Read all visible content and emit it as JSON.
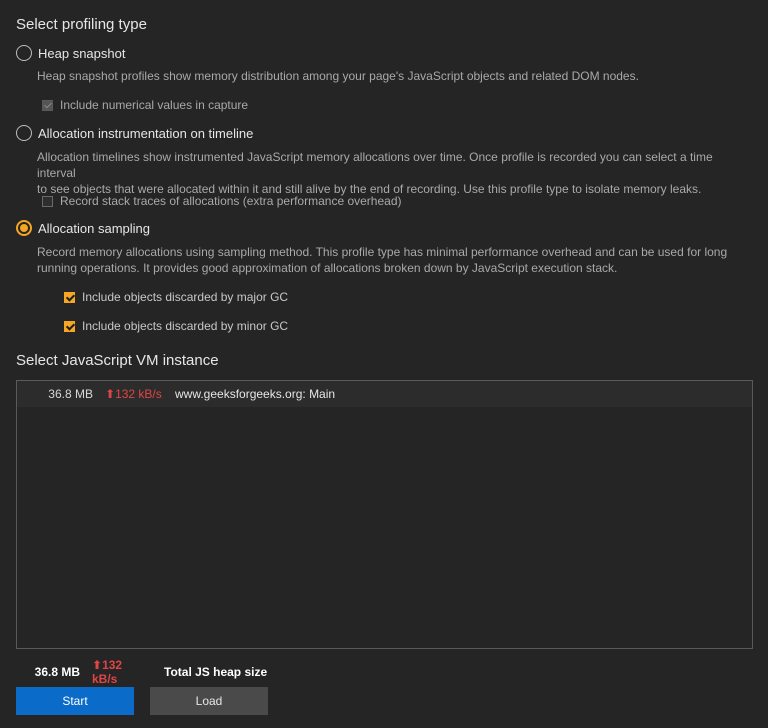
{
  "profiling": {
    "title": "Select profiling type",
    "options": [
      {
        "label": "Heap snapshot",
        "selected": false,
        "description": "Heap snapshot profiles show memory distribution among your page's JavaScript objects and related DOM nodes.",
        "checkboxes": [
          {
            "label": "Include numerical values in capture",
            "checked": true,
            "disabled": true
          }
        ]
      },
      {
        "label": "Allocation instrumentation on timeline",
        "selected": false,
        "description_lines": [
          "Allocation timelines show instrumented JavaScript memory allocations over time. Once profile is recorded you can select a time interval",
          "to see objects that were allocated within it and still alive by the end of recording. Use this profile type to isolate memory leaks."
        ],
        "checkboxes": [
          {
            "label": "Record stack traces of allocations (extra performance overhead)",
            "checked": false,
            "disabled": true
          }
        ]
      },
      {
        "label": "Allocation sampling",
        "selected": true,
        "description_lines": [
          "Record memory allocations using sampling method. This profile type has minimal performance overhead and can be used for long",
          "running operations. It provides good approximation of allocations broken down by JavaScript execution stack."
        ],
        "checkboxes": [
          {
            "label": "Include objects discarded by major GC",
            "checked": true,
            "disabled": false
          },
          {
            "label": "Include objects discarded by minor GC",
            "checked": true,
            "disabled": false
          }
        ]
      }
    ]
  },
  "vm": {
    "title": "Select JavaScript VM instance",
    "instances": [
      {
        "size": "36.8 MB",
        "rate_arrow": "⬆",
        "rate": "132 kB/s",
        "name": "www.geeksforgeeks.org: Main"
      }
    ]
  },
  "summary": {
    "size": "36.8 MB",
    "rate_arrow": "⬆",
    "rate": "132 kB/s",
    "label": "Total JS heap size"
  },
  "buttons": {
    "start": "Start",
    "load": "Load"
  },
  "colors": {
    "accent": "#f5a623",
    "primary_button": "#0a6bc9",
    "rate_red": "#e04545"
  }
}
